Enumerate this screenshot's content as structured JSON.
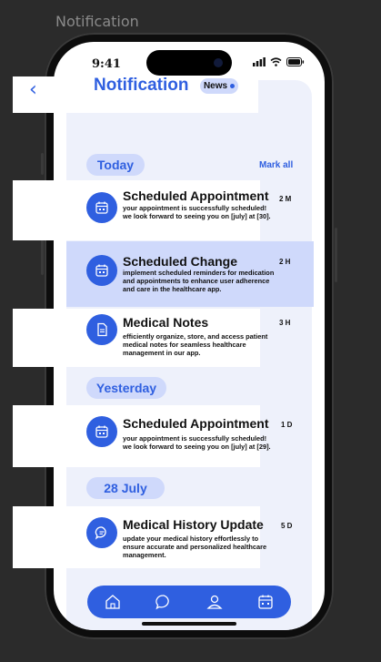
{
  "frame_label": "Notification",
  "status": {
    "time": "9:41"
  },
  "header": {
    "title": "Notification",
    "news_label": "News"
  },
  "sections": [
    {
      "label": "Today",
      "action": "Mark all"
    },
    {
      "label": "Yesterday"
    },
    {
      "label": "28 July"
    }
  ],
  "items": [
    {
      "title": "Scheduled Appointment",
      "body": "your appointment is successfully scheduled! we look forward to seeing you on [july] at [30].",
      "time": "2 M",
      "icon": "calendar-icon"
    },
    {
      "title": "Scheduled Change",
      "body": "implement scheduled reminders for medication and appointments to enhance user adherence and care in the healthcare app.",
      "time": "2 H",
      "icon": "calendar-icon",
      "highlighted": true
    },
    {
      "title": "Medical Notes",
      "body": "efficiently organize, store, and access patient medical notes for seamless healthcare management in our app.",
      "time": "3 H",
      "icon": "document-icon"
    },
    {
      "title": "Scheduled Appointment",
      "body": "your appointment is successfully scheduled! we look forward to seeing you on [july] at [29].",
      "time": "1 D",
      "icon": "calendar-icon"
    },
    {
      "title": "Medical History Update",
      "body": "update your medical history effortlessly to ensure accurate and personalized healthcare management.",
      "time": "5 D",
      "icon": "chat-icon"
    }
  ],
  "nav": [
    "home-icon",
    "chat-icon",
    "profile-icon",
    "calendar-icon"
  ],
  "colors": {
    "accent": "#2f5fe0",
    "highlight": "#cfd9fb",
    "background": "#eef1fb"
  }
}
